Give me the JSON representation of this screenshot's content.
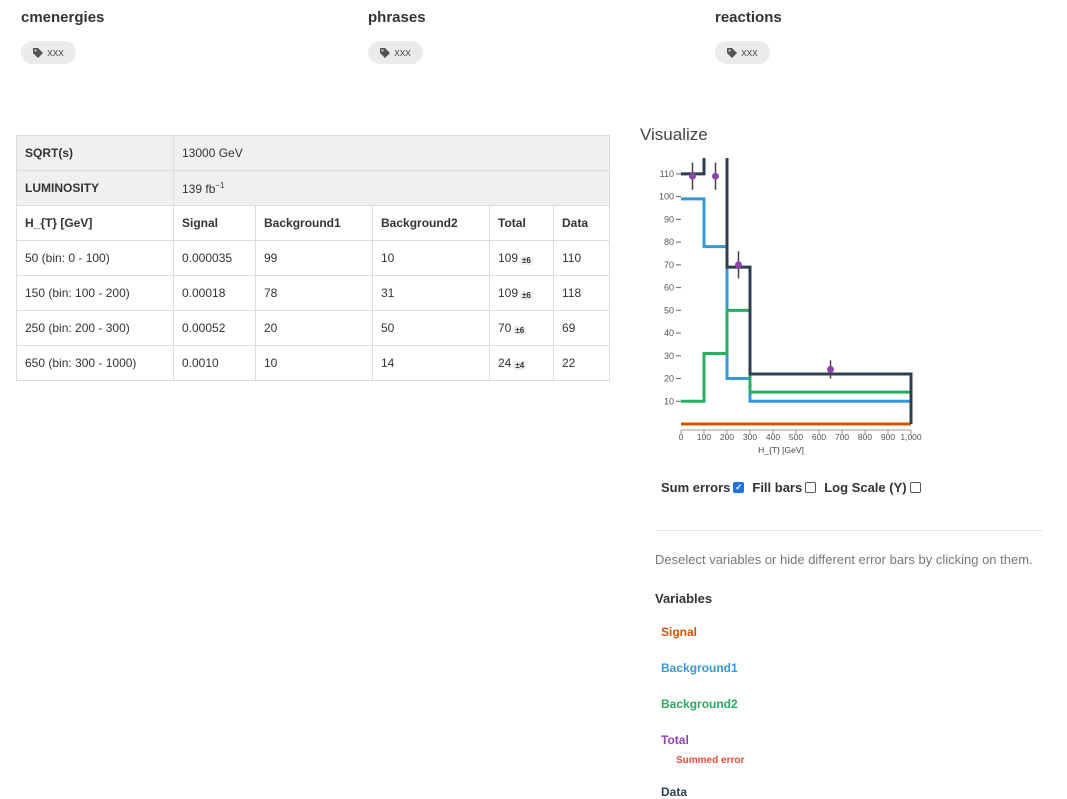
{
  "keywords": [
    {
      "title": "cmenergies",
      "tag": "xxx"
    },
    {
      "title": "phrases",
      "tag": "xxx"
    },
    {
      "title": "reactions",
      "tag": "xxx"
    }
  ],
  "table": {
    "sqrt_label": "SQRT(s)",
    "sqrt_value": "13000 GeV",
    "lumi_label": "LUMINOSITY",
    "lumi_value": "139 fb",
    "lumi_exp": "−1",
    "headers": [
      "H_{T} [GeV]",
      "Signal",
      "Background1",
      "Background2",
      "Total",
      "Data"
    ],
    "rows": [
      {
        "ht": "50 (bin: 0 - 100)",
        "signal": "0.000035",
        "bg1": "99",
        "bg2": "10",
        "total": "109",
        "err": "±6",
        "data": "110"
      },
      {
        "ht": "150 (bin: 100 - 200)",
        "signal": "0.00018",
        "bg1": "78",
        "bg2": "31",
        "total": "109",
        "err": "±6",
        "data": "118"
      },
      {
        "ht": "250 (bin: 200 - 300)",
        "signal": "0.00052",
        "bg1": "20",
        "bg2": "50",
        "total": "70",
        "err": "±6",
        "data": "69"
      },
      {
        "ht": "650 (bin: 300 - 1000)",
        "signal": "0.0010",
        "bg1": "10",
        "bg2": "14",
        "total": "24",
        "err": "±4",
        "data": "22"
      }
    ]
  },
  "visualize": {
    "title": "Visualize",
    "controls": {
      "sum_errors": "Sum errors",
      "fill_bars": "Fill bars",
      "log_scale": "Log Scale (Y)"
    },
    "hint": "Deselect variables or hide different error bars by clicking on them.",
    "variables_heading": "Variables",
    "variables": [
      {
        "label": "Signal",
        "color": "#d35400"
      },
      {
        "label": "Background1",
        "color": "#3498db"
      },
      {
        "label": "Background2",
        "color": "#27ae60"
      },
      {
        "label": "Total",
        "color": "#8e44ad"
      },
      {
        "label": "Data",
        "color": "#2c3e50"
      }
    ],
    "summed_error": "Summed error"
  },
  "chart_data": {
    "type": "line",
    "xlabel": "H_{T} [GeV]",
    "edges": [
      0,
      100,
      200,
      300,
      1000
    ],
    "x_ticks": [
      "0",
      "100",
      "200",
      "300",
      "400",
      "500",
      "600",
      "700",
      "800",
      "900",
      "1,000"
    ],
    "y_ticks": [
      "10",
      "20",
      "30",
      "40",
      "50",
      "60",
      "70",
      "80",
      "90",
      "100",
      "110"
    ],
    "ylim": [
      0,
      117
    ],
    "series": [
      {
        "name": "Signal",
        "color": "#d35400",
        "values": [
          3.5e-05,
          0.00018,
          0.00052,
          0.001
        ]
      },
      {
        "name": "Background1",
        "color": "#3498db",
        "values": [
          99,
          78,
          20,
          10
        ]
      },
      {
        "name": "Background2",
        "color": "#27ae60",
        "values": [
          10,
          31,
          50,
          14
        ]
      },
      {
        "name": "Total",
        "color": "#8e44ad",
        "values": [
          109,
          109,
          70,
          24
        ],
        "errors": [
          6,
          6,
          6,
          4
        ]
      },
      {
        "name": "Data",
        "color": "#2c3e50",
        "values": [
          110,
          118,
          69,
          22
        ]
      }
    ],
    "centers": [
      50,
      150,
      250,
      650
    ],
    "sum_errors": true,
    "fill_bars": false,
    "log_scale": false
  }
}
